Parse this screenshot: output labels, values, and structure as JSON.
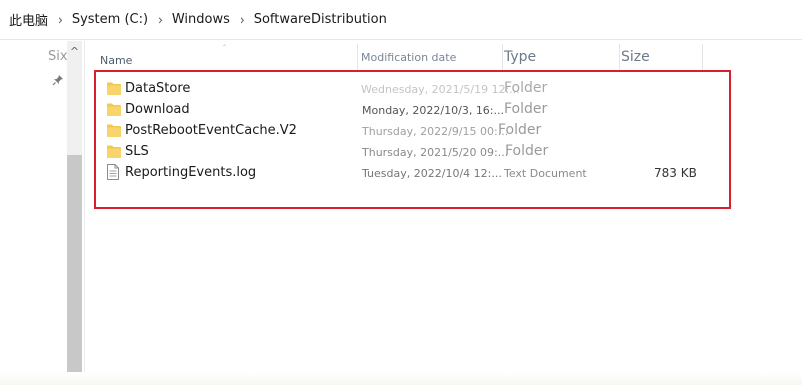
{
  "breadcrumb": {
    "items": [
      "此电脑",
      "System (C:)",
      "Windows",
      "SoftwareDistribution"
    ],
    "separator": "›"
  },
  "nav": {
    "truncated_label": "Six",
    "up_arrow": "^"
  },
  "columns": {
    "name": "Name",
    "modified": "Modification date",
    "type": "Type",
    "size": "Size"
  },
  "files": [
    {
      "name": "DataStore",
      "modified": "Wednesday, 2021/5/19 12:...",
      "type": "Folder",
      "size": "",
      "icon": "folder-icon"
    },
    {
      "name": "Download",
      "modified": "Monday, 2022/10/3, 16:...",
      "type": "Folder",
      "size": "",
      "icon": "folder-icon"
    },
    {
      "name": "PostRebootEventCache.V2",
      "modified": "Thursday, 2022/9/15 00:...",
      "type": "Folder",
      "size": "",
      "icon": "folder-icon"
    },
    {
      "name": "SLS",
      "modified": "Thursday, 2021/5/20 09:...",
      "type": "Folder",
      "size": "",
      "icon": "folder-icon"
    },
    {
      "name": "ReportingEvents.log",
      "modified": "Tuesday, 2022/10/4 12:...",
      "type": "Text Document",
      "size": "783 KB",
      "icon": "text-file-icon"
    }
  ],
  "colors": {
    "highlight": "#d6202d",
    "folder": "#f2c94c"
  }
}
